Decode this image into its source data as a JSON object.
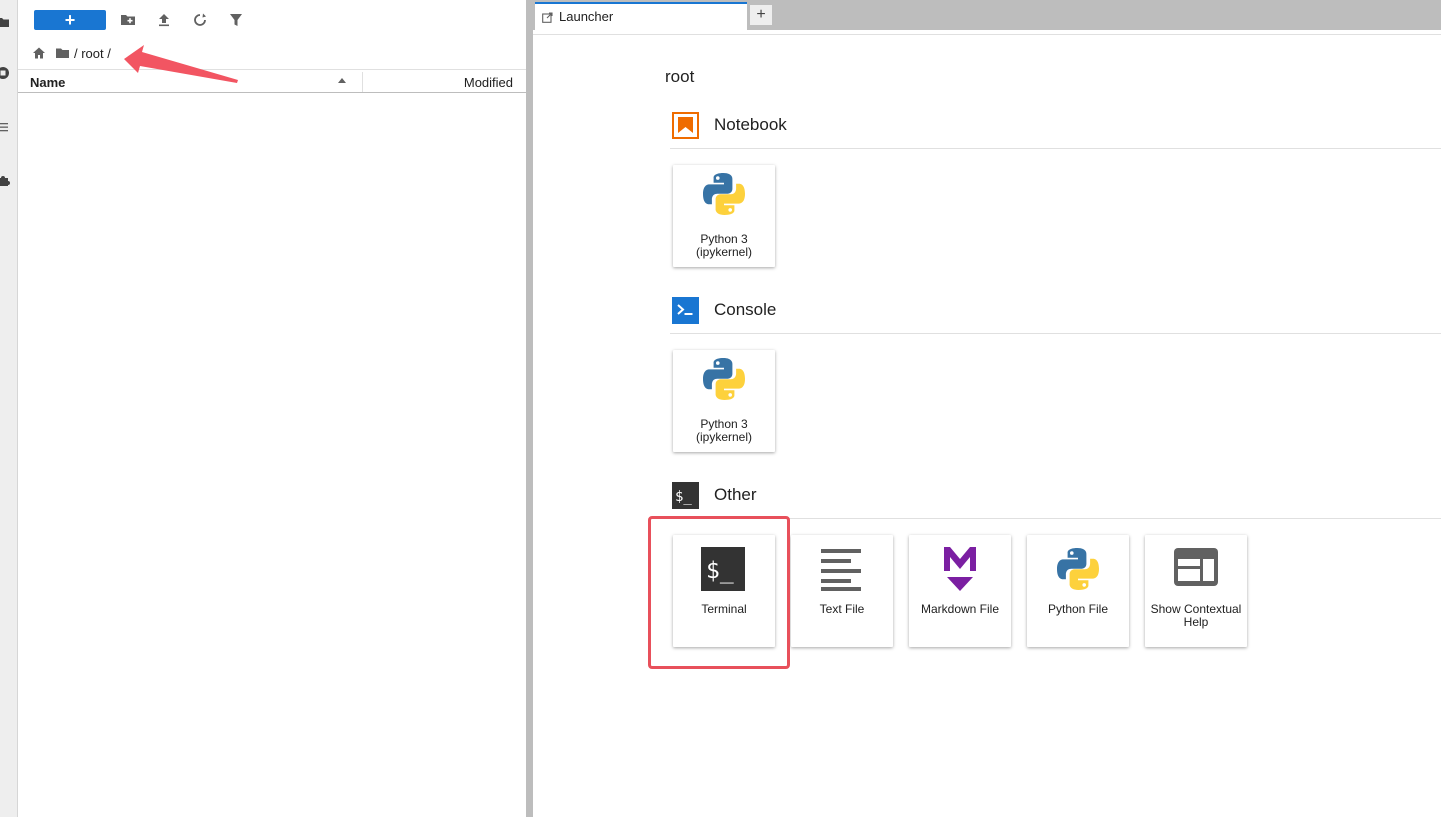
{
  "file_browser": {
    "new_button_label": "+",
    "breadcrumb_path": "/ root /",
    "columns": {
      "name": "Name",
      "modified": "Modified"
    }
  },
  "tabs": [
    {
      "label": "Launcher"
    }
  ],
  "add_tab_label": "+",
  "launcher": {
    "cwd": "root",
    "sections": {
      "notebook": {
        "title": "Notebook",
        "cards": [
          {
            "label": "Python 3 (ipykernel)"
          }
        ]
      },
      "console": {
        "title": "Console",
        "cards": [
          {
            "label": "Python 3 (ipykernel)"
          }
        ]
      },
      "other": {
        "title": "Other",
        "cards": [
          {
            "label": "Terminal"
          },
          {
            "label": "Text File"
          },
          {
            "label": "Markdown File"
          },
          {
            "label": "Python File"
          },
          {
            "label": "Show Contextual Help"
          }
        ]
      }
    }
  },
  "colors": {
    "accent": "#1976d2",
    "notebook_icon": "#ef6c00",
    "console_icon": "#1976d2",
    "other_icon": "#333333",
    "markdown_icon": "#7b1fa2",
    "highlight": "#e8505b"
  },
  "icons": [
    "folder-icon",
    "running-icon",
    "toc-icon",
    "extension-icon",
    "new-folder-icon",
    "upload-icon",
    "refresh-icon",
    "filter-icon",
    "home-icon",
    "python-icon",
    "terminal-icon",
    "text-file-icon",
    "markdown-icon",
    "contextual-help-icon"
  ]
}
